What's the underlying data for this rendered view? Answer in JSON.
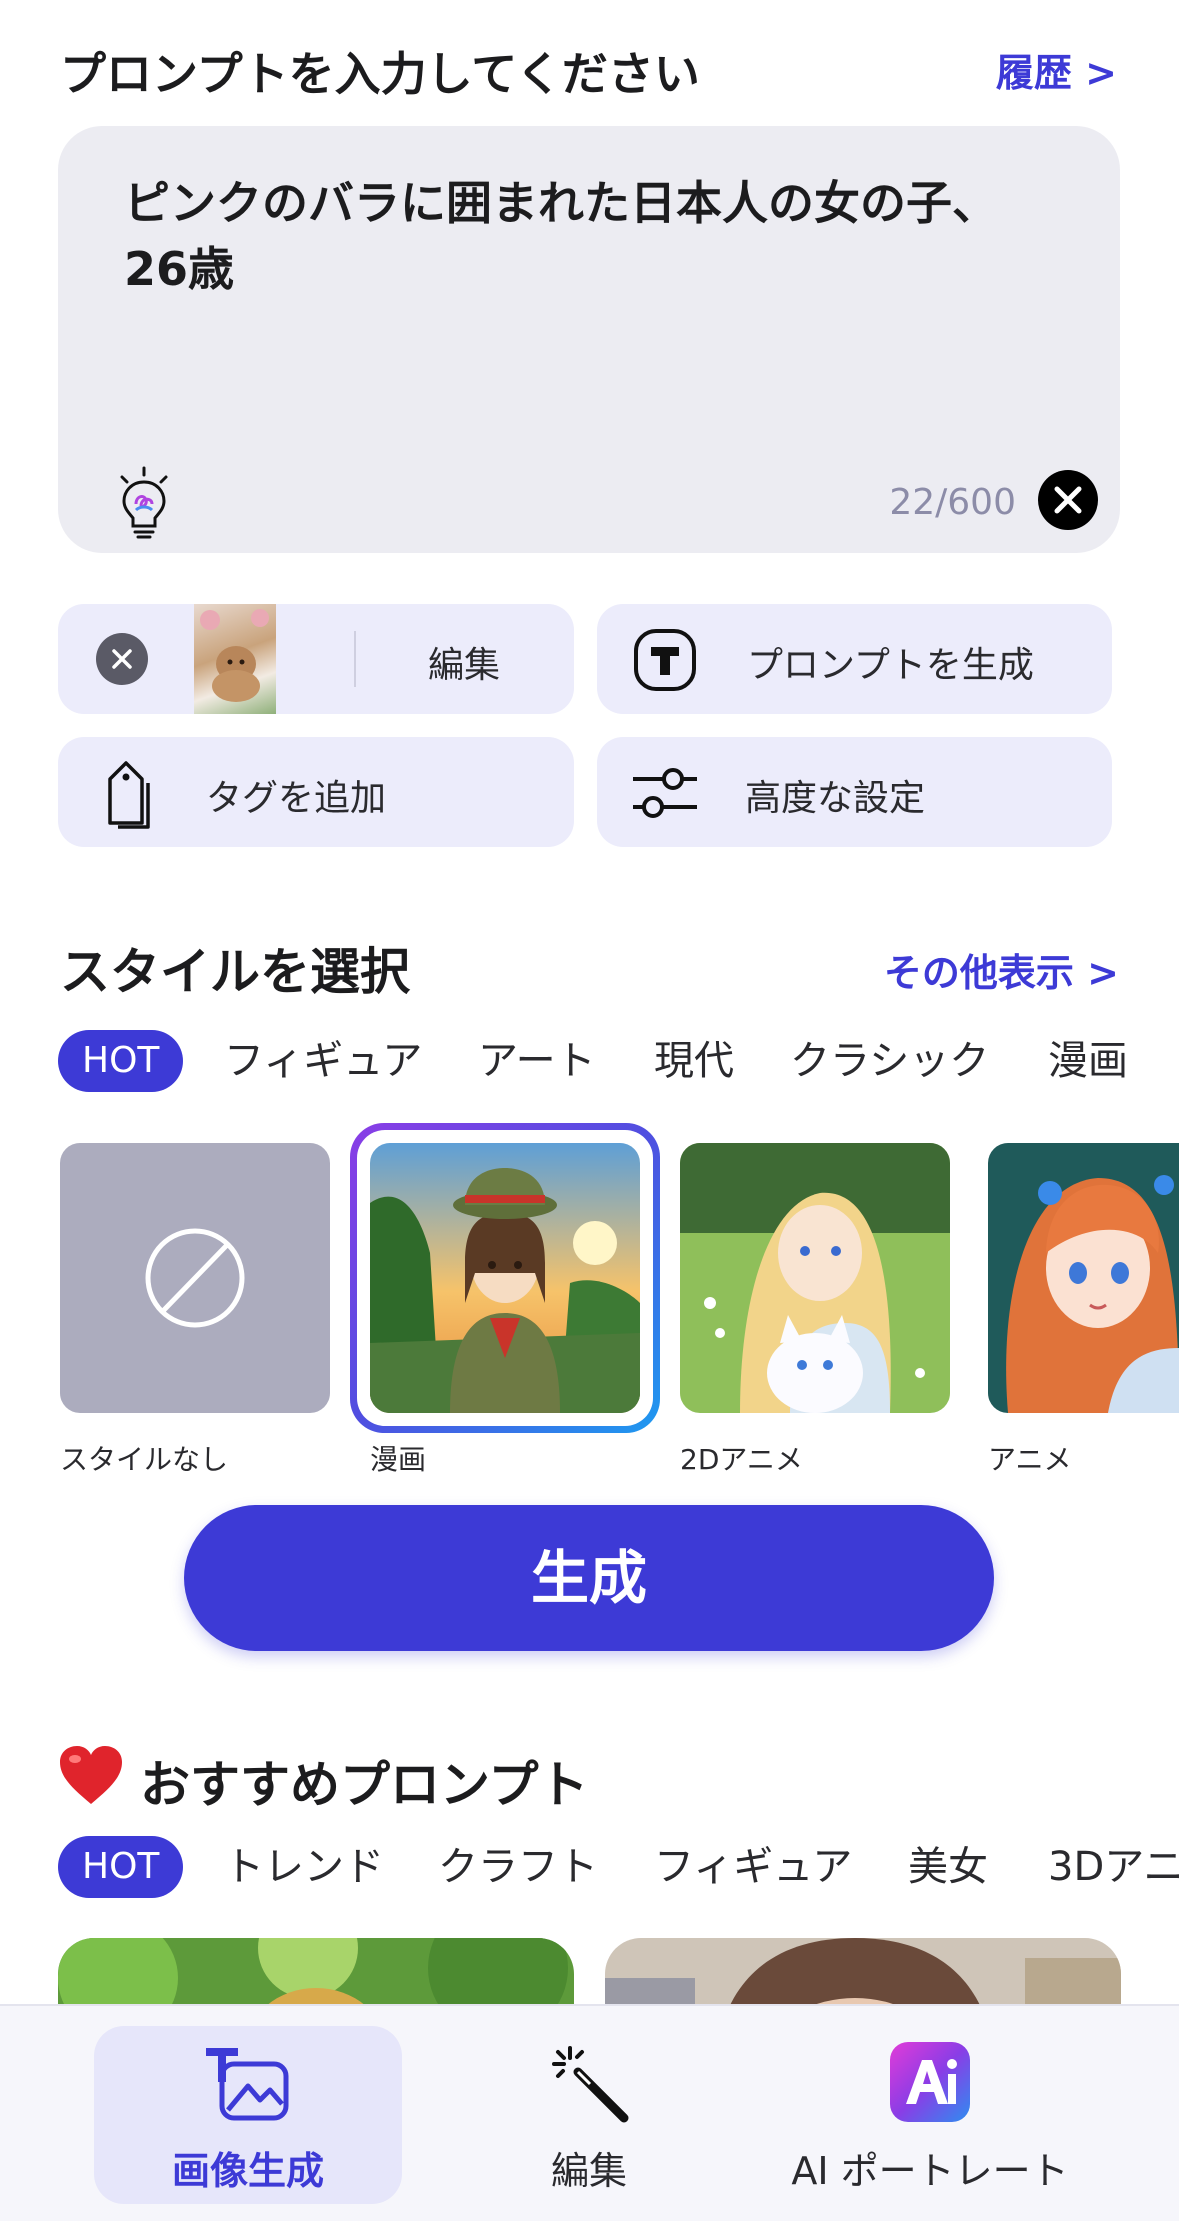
{
  "header": {
    "title": "プロンプトを入力してください",
    "history_link": "履歴 >"
  },
  "prompt": {
    "text_line1": "ピンクのバラに囲まれた日本人の女の子、",
    "text_line2": "26歳",
    "counter": "22/600"
  },
  "actions": {
    "edit_label": "編集",
    "generate_prompt_label": "プロンプトを生成",
    "add_tag_label": "タグを追加",
    "advanced_label": "高度な設定"
  },
  "style_section": {
    "title": "スタイルを選択",
    "more_link": "その他表示 >",
    "tabs": [
      "HOT",
      "フィギュア",
      "アート",
      "現代",
      "クラシック",
      "漫画"
    ],
    "tiles": [
      {
        "label": "スタイルなし",
        "selected": false
      },
      {
        "label": "漫画",
        "selected": true
      },
      {
        "label": "2Dアニメ",
        "selected": false
      },
      {
        "label": "アニメ",
        "selected": false
      }
    ]
  },
  "generate_button": "生成",
  "recommend_section": {
    "title": "おすすめプロンプト",
    "tabs": [
      "HOT",
      "トレンド",
      "クラフト",
      "フィギュア",
      "美女",
      "3Dアニ"
    ]
  },
  "bottom_nav": {
    "items": [
      {
        "label": "画像生成",
        "active": true
      },
      {
        "label": "編集",
        "active": false
      },
      {
        "label": "AI ポートレート",
        "active": false
      }
    ]
  },
  "colors": {
    "accent": "#3d3ad6",
    "card_bg": "#ececfb",
    "prompt_bg": "#ececf2"
  }
}
